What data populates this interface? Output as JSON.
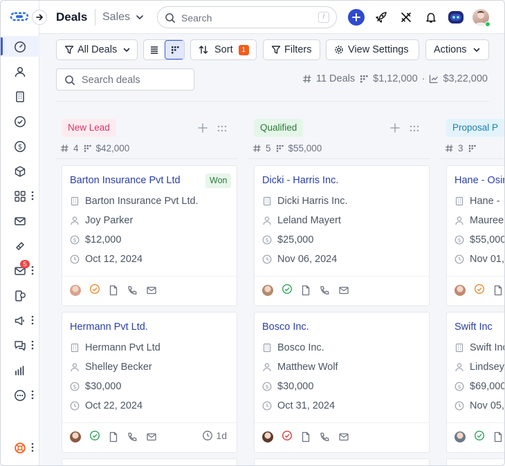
{
  "header": {
    "title": "Deals",
    "breadcrumb": "Sales",
    "search_placeholder": "Search",
    "search_shortcut": "/"
  },
  "sidebar": {
    "items": [
      {
        "name": "dashboard",
        "icon": "speedometer-icon",
        "active": true
      },
      {
        "name": "contacts",
        "icon": "person-icon"
      },
      {
        "name": "companies",
        "icon": "building-icon"
      },
      {
        "name": "tasks",
        "icon": "check-circle-icon"
      },
      {
        "name": "deals",
        "icon": "dollar-circle-icon"
      },
      {
        "name": "products",
        "icon": "cube-icon"
      },
      {
        "name": "apps",
        "icon": "apps-icon",
        "more": true
      },
      {
        "name": "mail",
        "icon": "envelope-icon"
      },
      {
        "name": "tickets",
        "icon": "ticket-icon"
      },
      {
        "name": "inbox",
        "icon": "inbox-icon",
        "more": true,
        "badge": "5"
      },
      {
        "name": "calls",
        "icon": "phone-chat-icon"
      },
      {
        "name": "campaigns",
        "icon": "megaphone-icon",
        "more": true
      },
      {
        "name": "conversations",
        "icon": "chat-icon",
        "more": true
      },
      {
        "name": "reports",
        "icon": "bar-chart-icon"
      },
      {
        "name": "more",
        "icon": "more-circle-icon",
        "more": true
      },
      {
        "name": "support",
        "icon": "lifebuoy-icon",
        "more": true
      }
    ]
  },
  "toolbar": {
    "view_filter": "All Deals",
    "sort_label": "Sort",
    "sort_count": "1",
    "filters_label": "Filters",
    "view_settings_label": "View Settings",
    "actions_label": "Actions",
    "deal_search_placeholder": "Search deals",
    "summary": {
      "deals": "11 Deals",
      "pipeline": "$1,12,000",
      "forecast": "$3,22,000"
    }
  },
  "colors": {
    "accent": "#2f4ad0",
    "title_link": "#2a3fa8"
  },
  "columns": [
    {
      "name": "New Lead",
      "count": "4",
      "amount": "$42,000",
      "tag_bg": "#fdecef",
      "tag_fg": "#d6336c",
      "cards": [
        {
          "title": "Barton Insurance Pvt Ltd",
          "badge": "Won",
          "company": "Barton Insurance Pvt Ltd.",
          "contact": "Joy Parker",
          "amount": "$12,000",
          "date": "Oct 12, 2024",
          "status": "warning",
          "age": ""
        },
        {
          "title": "Hermann Pvt Ltd.",
          "badge": "",
          "company": "Hermann Pvt Ltd",
          "contact": "Shelley Becker",
          "amount": "$30,000",
          "date": "Oct 22, 2024",
          "status": "success",
          "age": "1d"
        }
      ]
    },
    {
      "name": "Qualified",
      "count": "5",
      "amount": "$55,000",
      "tag_bg": "#e4f6e8",
      "tag_fg": "#2f7a3b",
      "cards": [
        {
          "title": "Dicki - Harris Inc.",
          "badge": "",
          "company": "Dicki Harris Inc.",
          "contact": "Leland Mayert",
          "amount": "$25,000",
          "date": "Nov 06, 2024",
          "status": "success",
          "age": ""
        },
        {
          "title": "Bosco Inc.",
          "badge": "",
          "company": "Bosco Inc.",
          "contact": "Matthew Wolf",
          "amount": "$30,000",
          "date": "Oct 31, 2024",
          "status": "error",
          "age": ""
        }
      ]
    },
    {
      "name": "Proposal P",
      "count": "3",
      "amount": "",
      "tag_bg": "#e3f3fb",
      "tag_fg": "#1c7fae",
      "cards": [
        {
          "title": "Hane - Osin",
          "badge": "",
          "company": "Hane -",
          "contact": "Mauree",
          "amount": "$55,000",
          "date": "Nov 01,",
          "status": "warning",
          "age": ""
        },
        {
          "title": "Swift Inc",
          "badge": "",
          "company": "Swift Inc",
          "contact": "Lindsey",
          "amount": "$69,000",
          "date": "Nov 05,",
          "status": "success",
          "age": ""
        }
      ]
    }
  ]
}
